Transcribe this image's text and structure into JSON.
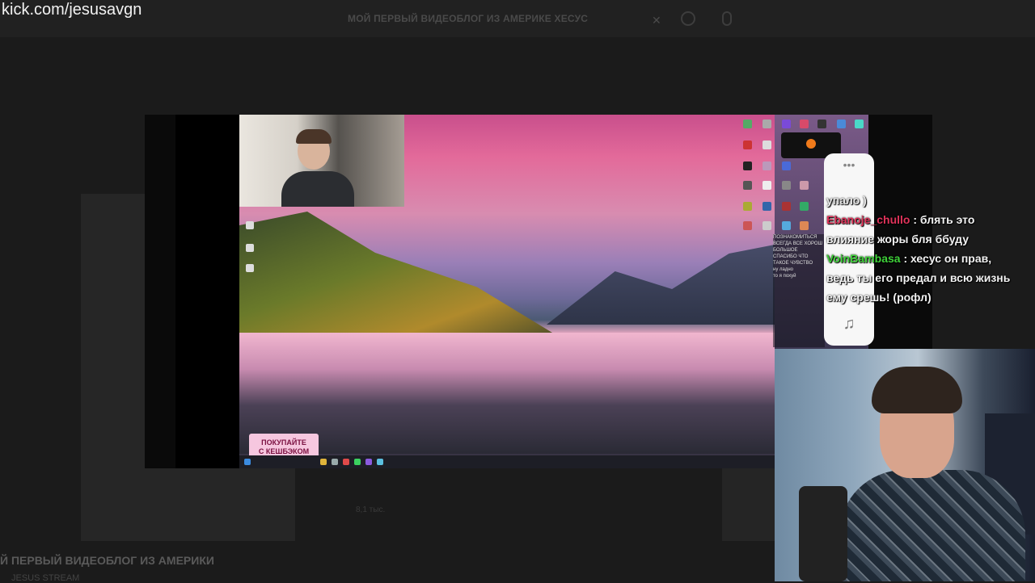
{
  "overlay": {
    "watermark": "kick.com/jesusavgn"
  },
  "background_page": {
    "tab_title": "МОЙ ПЕРВЫЙ ВИДЕОБЛОГ ИЗ АМЕРИКЕ ХЕСУС",
    "video_title": "Й ПЕРВЫЙ ВИДЕОБЛОГ ИЗ АМЕРИКИ",
    "sub_label": "JESUS STREAM",
    "views_hint": "8,1 тыс."
  },
  "desktop": {
    "promo": {
      "line1": "ПОКУПАЙТЕ",
      "line2": "С КЕШБЭКОМ"
    }
  },
  "phone": {
    "menu_icon": "ellipsis-icon",
    "music_icon": "music-note-icon"
  },
  "chat": {
    "partial_top": "упало )",
    "messages": [
      {
        "user": "Ebanoje_chullo",
        "user_color": "#e0335a",
        "text": ": блять это влияние жоры бля ббуду"
      },
      {
        "user": "VoinBambasa",
        "user_color": "#3fd13a",
        "text": ": хесус он прав, ведь ты его предал и всю жизнь ему срешь! (рофл)"
      }
    ]
  },
  "mini_chat_lines": [
    "ПОЗНАКОМИТЬСЯ",
    "ВСЕГДА ВСЕ ХОРОШ",
    "БОЛЬШОЕ",
    "СПАСИБО ЧТО",
    "ТАКОЕ ЧУВСТВО",
    "ну ладно",
    "то я похуй"
  ]
}
